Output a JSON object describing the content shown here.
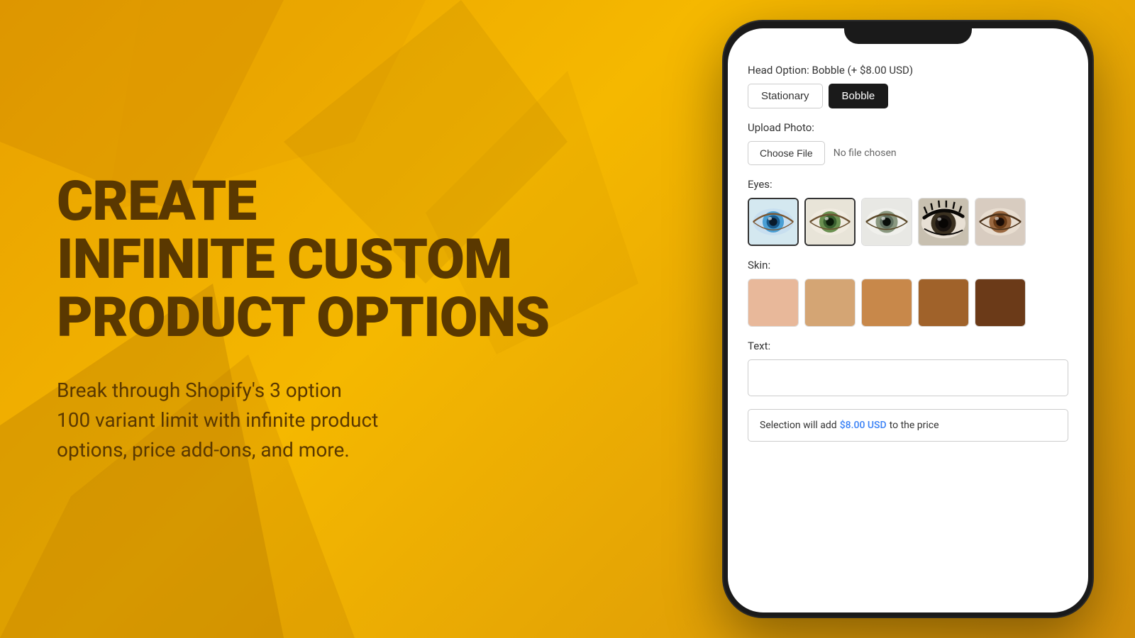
{
  "background": {
    "color": "#f0a800"
  },
  "left": {
    "headline_line1": "CREATE",
    "headline_line2": "INFINITE CUSTOM",
    "headline_line3": "PRODUCT OPTIONS",
    "subtext": "Break through Shopify’s 3 option\n100 variant limit with infinite product\noptions, price add-ons, and more."
  },
  "phone": {
    "head_option": {
      "label": "Head Option:",
      "selected_label": "Bobble",
      "price_label": "(+ $8.00 USD)",
      "buttons": [
        {
          "id": "stationary",
          "label": "Stationary",
          "active": false
        },
        {
          "id": "bobble",
          "label": "Bobble",
          "active": true
        }
      ]
    },
    "upload_photo": {
      "label": "Upload Photo:",
      "choose_file_label": "Choose File",
      "no_file_label": "No file chosen"
    },
    "eyes": {
      "label": "Eyes:",
      "swatches": [
        {
          "id": "eye1",
          "selected": true,
          "color_iris": "#4a9fd4",
          "color_ring": "#2a6fa8"
        },
        {
          "id": "eye2",
          "selected": true,
          "color_iris": "#4a8040",
          "color_ring": "#2d5c2a"
        },
        {
          "id": "eye3",
          "selected": false,
          "color_iris": "#7a9a80",
          "color_ring": "#5a7860"
        },
        {
          "id": "eye4",
          "selected": false,
          "color_iris": "#1a1a1a",
          "color_ring": "#0a0a0a"
        },
        {
          "id": "eye5",
          "selected": false,
          "color_iris": "#8B5E3C",
          "color_ring": "#5a3820"
        }
      ]
    },
    "skin": {
      "label": "Skin:",
      "swatches": [
        {
          "id": "skin1",
          "color": "#e8b89a",
          "selected": false
        },
        {
          "id": "skin2",
          "color": "#d4a574",
          "selected": false
        },
        {
          "id": "skin3",
          "color": "#c8884a",
          "selected": false
        },
        {
          "id": "skin4",
          "color": "#a0622a",
          "selected": false
        },
        {
          "id": "skin5",
          "color": "#6b3a18",
          "selected": false
        }
      ]
    },
    "text_field": {
      "label": "Text:",
      "placeholder": "",
      "value": ""
    },
    "price_bar": {
      "prefix": "Selection will add",
      "price": "$8.00 USD",
      "suffix": "to the price"
    }
  }
}
